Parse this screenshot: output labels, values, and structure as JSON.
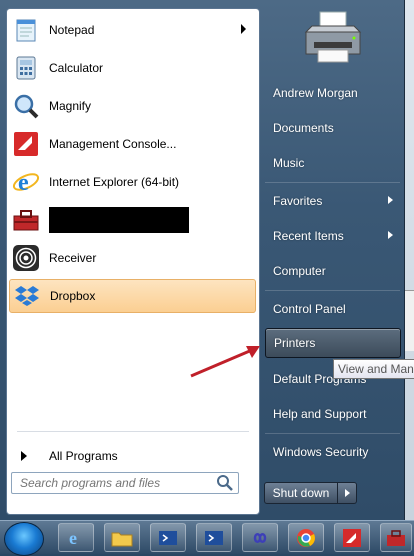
{
  "programs": [
    {
      "label": "Notepad",
      "icon": "notepad-icon",
      "submenu": true
    },
    {
      "label": "Calculator",
      "icon": "calculator-icon",
      "submenu": false
    },
    {
      "label": "Magnify",
      "icon": "magnifier-icon",
      "submenu": false
    },
    {
      "label": "Management Console...",
      "icon": "management-console-icon",
      "submenu": false
    },
    {
      "label": "Internet Explorer (64-bit)",
      "icon": "internet-explorer-icon",
      "submenu": false
    },
    {
      "label": "",
      "icon": "toolbox-icon",
      "submenu": false,
      "redacted": true
    },
    {
      "label": "Receiver",
      "icon": "receiver-icon",
      "submenu": false
    },
    {
      "label": "Dropbox",
      "icon": "dropbox-icon",
      "submenu": false,
      "highlighted": true
    }
  ],
  "all_programs_label": "All Programs",
  "search": {
    "placeholder": "Search programs and files"
  },
  "right_pane": [
    {
      "label": "Andrew Morgan"
    },
    {
      "label": "Documents"
    },
    {
      "label": "Music"
    },
    {
      "label": "Favorites",
      "submenu": true
    },
    {
      "label": "Recent Items",
      "submenu": true
    },
    {
      "label": "Computer"
    },
    {
      "label": "Control Panel"
    },
    {
      "label": "Printers",
      "selected": true
    },
    {
      "label": "Default Programs"
    },
    {
      "label": "Help and Support"
    },
    {
      "label": "Windows Security"
    }
  ],
  "tooltip": "View and Mana",
  "shutdown_label": "Shut down",
  "colors": {
    "highlight": "#fbcf92",
    "menu_bg": "#3a5875",
    "arrow": "#c0202a"
  },
  "taskbar_icons": [
    "internet-explorer-icon",
    "folder-icon",
    "powershell-icon",
    "powershell-icon",
    "infinity-icon",
    "chrome-icon",
    "adobe-reader-icon",
    "toolbox-icon"
  ]
}
